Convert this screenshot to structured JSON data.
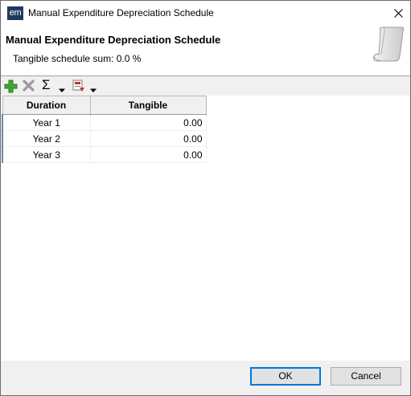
{
  "window": {
    "title": "Manual Expenditure Depreciation Schedule",
    "app_icon_text": "em"
  },
  "header": {
    "title": "Manual Expenditure Depreciation Schedule",
    "subtitle": "Tangible schedule sum: 0.0 %"
  },
  "toolbar": {
    "icons": [
      "add-icon",
      "delete-icon",
      "sigma-icon",
      "dropdown-arrow-icon",
      "export-icon",
      "dropdown-arrow-icon"
    ],
    "sigma_glyph": "Σ"
  },
  "grid": {
    "columns": [
      "Duration",
      "Tangible"
    ],
    "rows": [
      {
        "duration": "Year 1",
        "tangible": "0.00"
      },
      {
        "duration": "Year 2",
        "tangible": "0.00"
      },
      {
        "duration": "Year 3",
        "tangible": "0.00"
      }
    ]
  },
  "footer": {
    "ok_label": "OK",
    "cancel_label": "Cancel"
  },
  "colors": {
    "accent": "#0078d7",
    "add_green": "#3fa535",
    "delete_gray": "#9a9a9a"
  }
}
